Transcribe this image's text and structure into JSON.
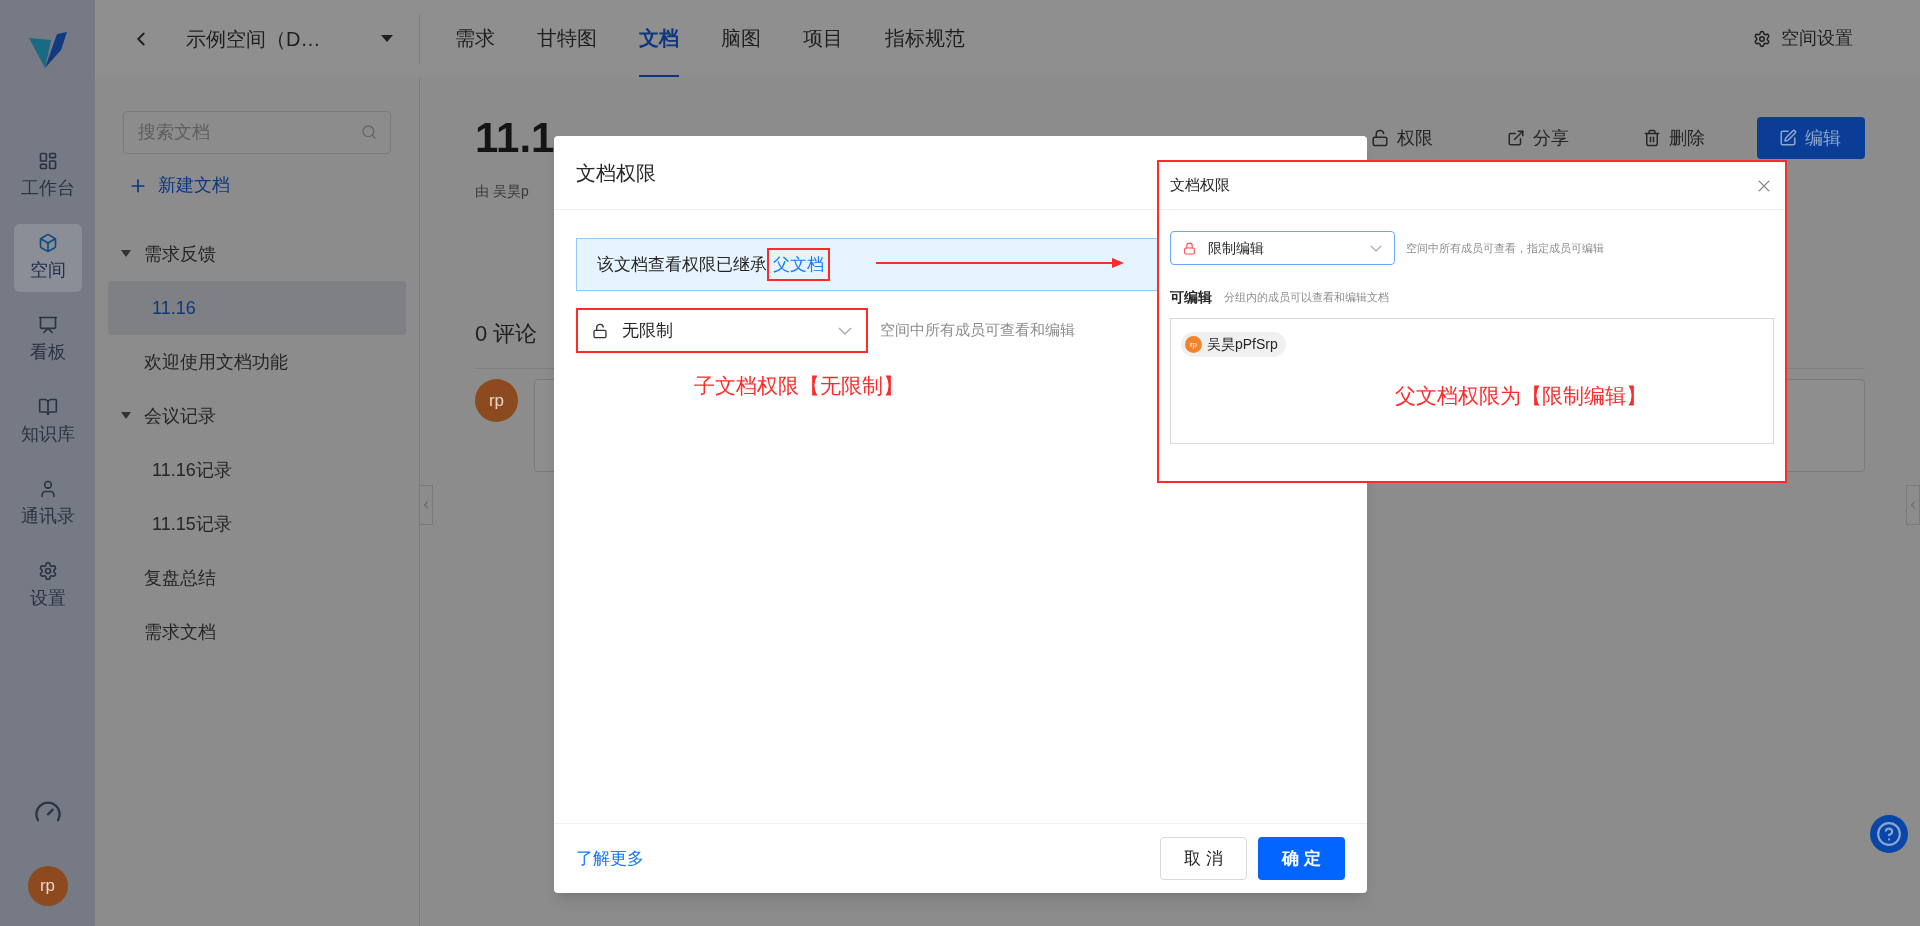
{
  "nav": {
    "items": [
      {
        "label": "工作台",
        "selected": false
      },
      {
        "label": "空间",
        "selected": true
      },
      {
        "label": "看板",
        "selected": false
      },
      {
        "label": "知识库",
        "selected": false
      },
      {
        "label": "通讯录",
        "selected": false
      },
      {
        "label": "设置",
        "selected": false
      }
    ],
    "user_avatar": "rp"
  },
  "space": {
    "name": "示例空间（D…"
  },
  "tabs": [
    {
      "label": "需求",
      "selected": false
    },
    {
      "label": "甘特图",
      "selected": false
    },
    {
      "label": "文档",
      "selected": true
    },
    {
      "label": "脑图",
      "selected": false
    },
    {
      "label": "项目",
      "selected": false
    },
    {
      "label": "指标规范",
      "selected": false
    }
  ],
  "space_settings": "空间设置",
  "sidebar": {
    "search_placeholder": "搜索文档",
    "new_doc": "新建文档",
    "tree": [
      {
        "label": "需求反馈",
        "selected": false,
        "expanded": true,
        "children": [
          {
            "label": "11.16",
            "selected": true
          }
        ]
      },
      {
        "label": "欢迎使用文档功能",
        "selected": false
      },
      {
        "label": "会议记录",
        "selected": false,
        "expanded": true,
        "children": [
          {
            "label": "11.16记录",
            "selected": false
          },
          {
            "label": "11.15记录",
            "selected": false
          }
        ]
      },
      {
        "label": "复盘总结",
        "selected": false
      },
      {
        "label": "需求文档",
        "selected": false
      }
    ]
  },
  "document": {
    "title": "11.1",
    "byline": "由 吴昊p",
    "actions": [
      {
        "label": "权限",
        "kind": "lock"
      },
      {
        "label": "分享",
        "kind": "share"
      },
      {
        "label": "删除",
        "kind": "delete"
      },
      {
        "label": "编辑",
        "kind": "edit"
      }
    ],
    "comments_heading": "0 评论",
    "comment_avatar": "rp"
  },
  "dialog": {
    "title": "文档权限",
    "notice": "该文档查看权限已继承",
    "notice_link": "父文档",
    "permission": {
      "value": "无限制",
      "hint": "空间中所有成员可查看和编辑"
    },
    "annotation": "子文档权限【无限制】",
    "learn_more": "了解更多",
    "buttons": [
      {
        "label": "取 消",
        "kind": "secondary"
      },
      {
        "label": "确 定",
        "kind": "primary"
      }
    ]
  },
  "parent_dialog": {
    "title": "文档权限",
    "permission": {
      "value": "限制编辑",
      "hint": "空间中所有成员可查看，指定成员可编辑"
    },
    "editors_label": "可编辑",
    "editors_hint": "分组内的成员可以查看和编辑文档",
    "members": [
      {
        "avatar": "rp",
        "name": "吴昊pPfSrp"
      }
    ],
    "annotation": "父文档权限为【限制编辑】"
  }
}
